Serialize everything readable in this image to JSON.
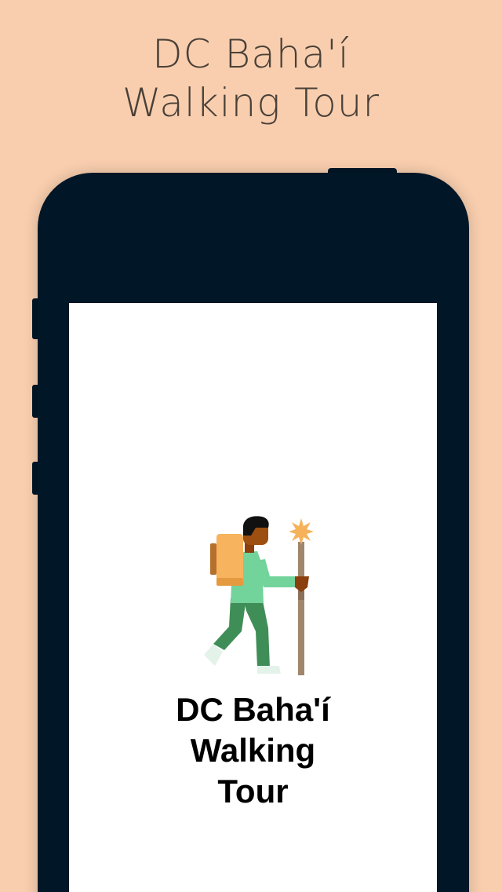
{
  "promo": {
    "title_line1": "DC Baha'í",
    "title_line2": "Walking Tour"
  },
  "app": {
    "title_line1": "DC Baha'í",
    "title_line2": "Walking",
    "title_line3": "Tour",
    "illustration_icon": "hiker-icon"
  },
  "colors": {
    "background": "#f8ceae",
    "device": "#011627",
    "screen": "#ffffff",
    "backpack": "#f7b35e",
    "shirt": "#72d39b",
    "pants": "#3f8e57",
    "skin": "#9c4f10",
    "staff": "#a0876b",
    "star": "#f5b25a"
  }
}
